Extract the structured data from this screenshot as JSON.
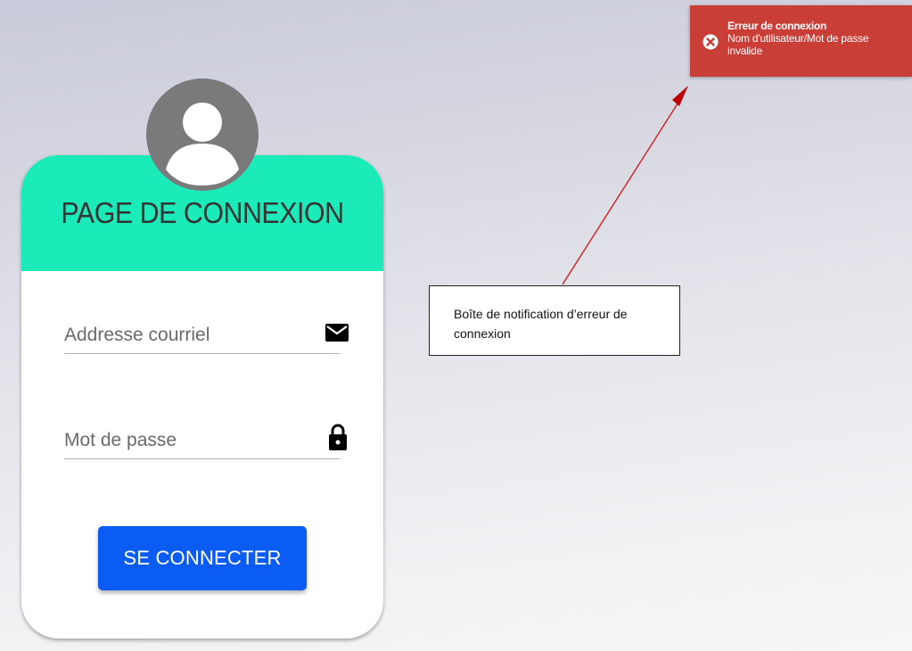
{
  "login": {
    "title": "PAGE DE CONNEXION",
    "email_placeholder": "Addresse courriel",
    "email_value": "",
    "password_placeholder": "Mot de passe",
    "password_value": "",
    "submit_label": "SE CONNECTER"
  },
  "toast": {
    "title": "Erreur de connexion",
    "message": "Nom d'utilisateur/Mot de passe invalide",
    "icon": "close-circle-icon"
  },
  "annotation": {
    "text": "Boîte de notification d’erreur de connexion"
  },
  "icons": {
    "avatar": "user-avatar-icon",
    "email": "envelope-icon",
    "password": "lock-icon"
  },
  "colors": {
    "header": "#1beab9",
    "button": "#0b5cf5",
    "toast": "#c93e36",
    "arrow": "#d11f1f"
  }
}
